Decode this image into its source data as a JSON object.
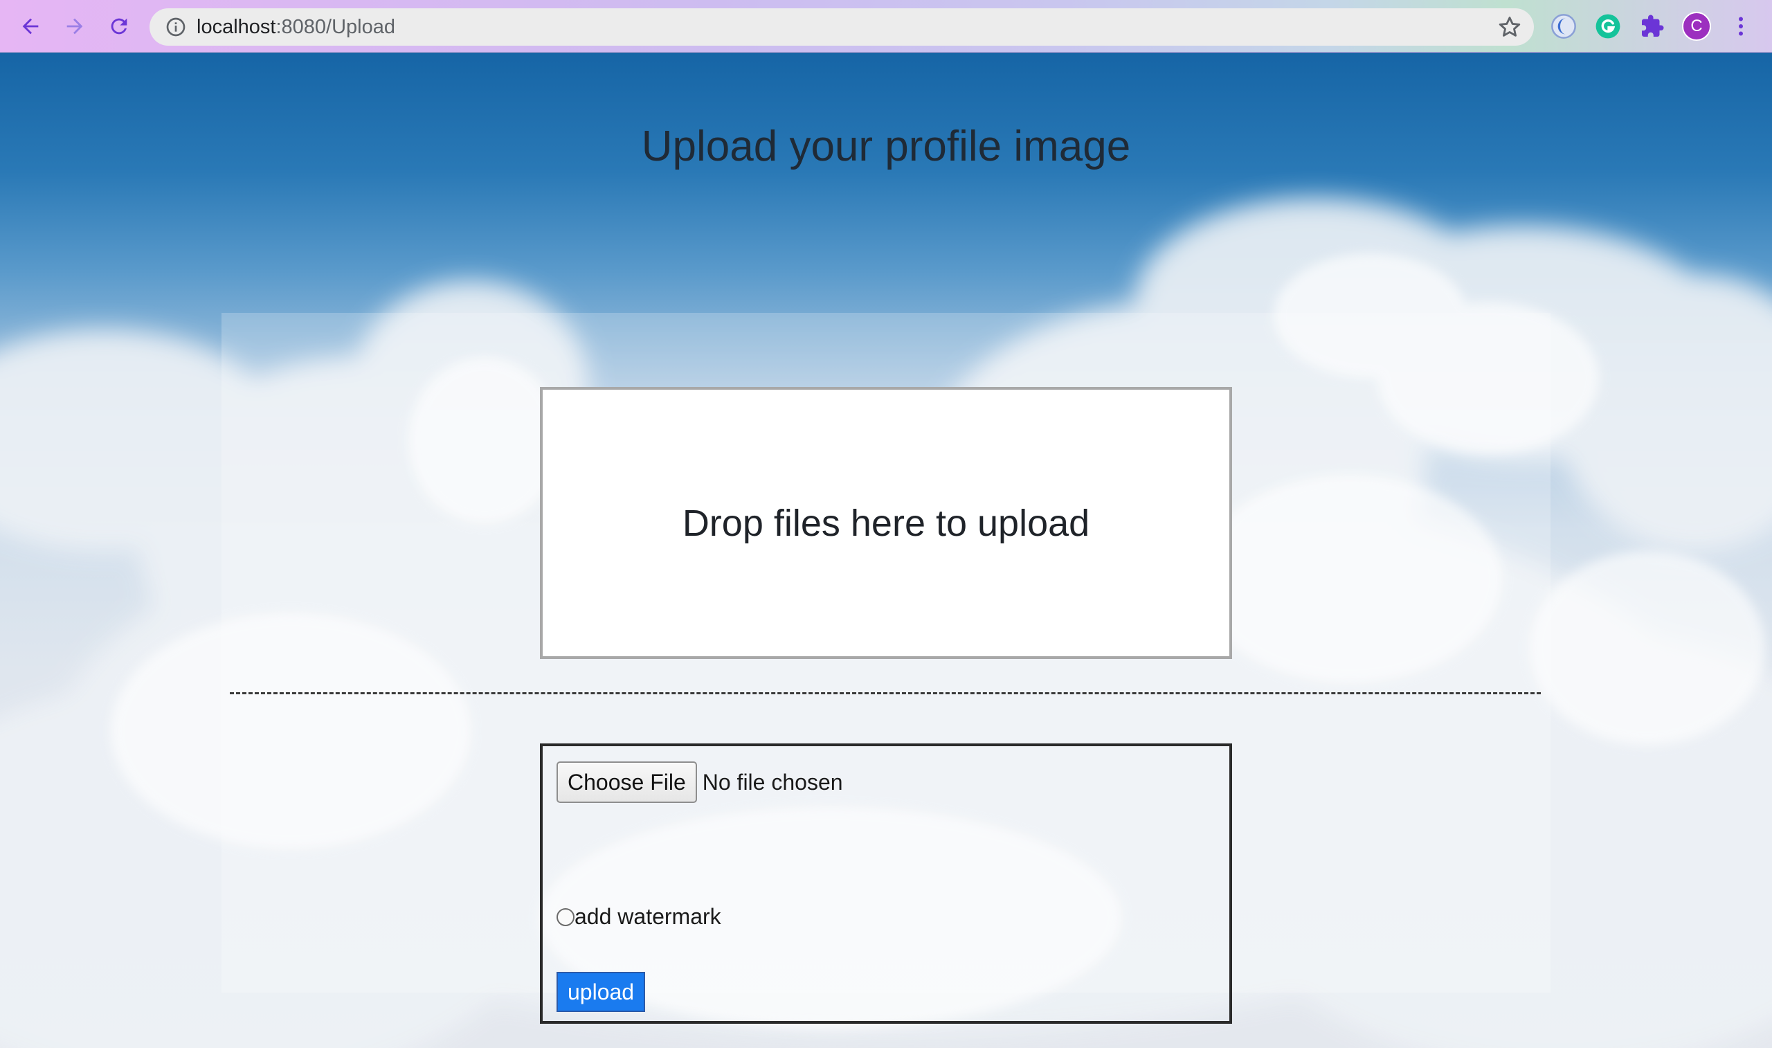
{
  "browser": {
    "url_host": "localhost",
    "url_path": ":8080/Upload",
    "profile_initial": "C",
    "accent_color": "#7b3fe0"
  },
  "page": {
    "title": "Upload your profile image",
    "dropzone_text": "Drop files here to upload",
    "choose_file_label": "Choose File",
    "file_status": "No file chosen",
    "watermark_label": "add watermark",
    "upload_label": "upload",
    "upload_color": "#1a7bef"
  }
}
